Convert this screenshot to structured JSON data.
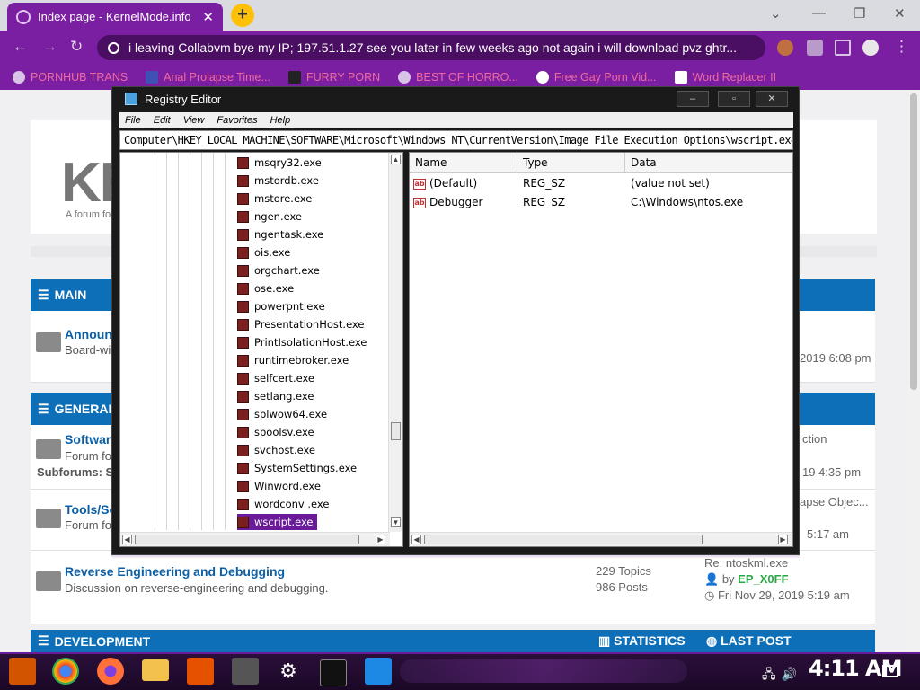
{
  "browser": {
    "tab_title": "Index page - KernelMode.info",
    "tab_close": "✕",
    "new_tab": "+",
    "omnibox_text": "i leaving Collabvm bye my IP; 197.51.1.27 see you later in few weeks ago not again i will download pvz ghtr...",
    "window_min": "⌄",
    "window_minimize": "—",
    "window_restore": "❐",
    "window_close": "✕"
  },
  "bookmarks": [
    {
      "label": "PORNHUB TRANS"
    },
    {
      "label": "Anal Prolapse Time..."
    },
    {
      "label": "FURRY PORN"
    },
    {
      "label": "BEST OF HORRO..."
    },
    {
      "label": "Free Gay Porn Vid..."
    },
    {
      "label": "Word Replacer II"
    }
  ],
  "forum": {
    "logo": "KE",
    "logo_sub": "A forum fo",
    "main_bar": "MAIN",
    "general_bar": "GENERAL",
    "development_bar": "DEVELOPMENT",
    "statistics": "STATISTICS",
    "last_post": "LAST POST",
    "rows": [
      {
        "title": "Announ",
        "desc": "Board-wi",
        "last": "2019 6:08 pm"
      },
      {
        "title": "Software",
        "desc": "Forum fo",
        "sub": "Subforums: S",
        "last_title": "ction",
        "last_date": "19 4:35 pm"
      },
      {
        "title": "Tools/So",
        "desc": "Forum fo",
        "last_title": "apse Objec...",
        "last_date": "5:17 am"
      },
      {
        "title": "Reverse Engineering and Debugging",
        "desc": "Discussion on reverse-engineering and debugging.",
        "topics": "229 Topics",
        "posts": "986 Posts",
        "last_title": "Re: ntoskml.exe",
        "last_by": "by",
        "last_user": "EP_X0FF",
        "last_date": "Fri Nov 29, 2019 5:19 am"
      }
    ]
  },
  "regedit": {
    "title": "Registry Editor",
    "menu": [
      "File",
      "Edit",
      "View",
      "Favorites",
      "Help"
    ],
    "address": "Computer\\HKEY_LOCAL_MACHINE\\SOFTWARE\\Microsoft\\Windows NT\\CurrentVersion\\Image File Execution Options\\wscript.exe",
    "tree": [
      "msqry32.exe",
      "mstordb.exe",
      "mstore.exe",
      "ngen.exe",
      "ngentask.exe",
      "ois.exe",
      "orgchart.exe",
      "ose.exe",
      "powerpnt.exe",
      "PresentationHost.exe",
      "PrintIsolationHost.exe",
      "runtimebroker.exe",
      "selfcert.exe",
      "setlang.exe",
      "splwow64.exe",
      "spoolsv.exe",
      "svchost.exe",
      "SystemSettings.exe",
      "Winword.exe",
      "wordconv .exe",
      "wscript.exe"
    ],
    "selected": "wscript.exe",
    "columns": [
      "Name",
      "Type",
      "Data"
    ],
    "values": [
      {
        "name": "(Default)",
        "type": "REG_SZ",
        "data": "(value not set)"
      },
      {
        "name": "Debugger",
        "type": "REG_SZ",
        "data": "C:\\Windows\\ntos.exe"
      }
    ]
  },
  "taskbar": {
    "clock": "4:11 AM"
  },
  "colors": {
    "chrome_purple": "#7b1fa2",
    "forum_blue": "#0d6fb8",
    "link_blue": "#0b5fa5",
    "user_green": "#28a745"
  }
}
